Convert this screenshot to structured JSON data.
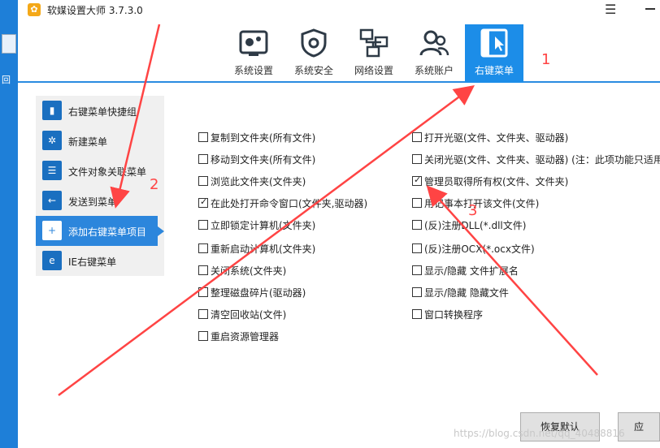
{
  "app": {
    "title": "软媒设置大师 3.7.3.0",
    "logo_icon": "gear-logo-icon"
  },
  "desktop": {
    "icon_label": "回"
  },
  "nav": {
    "tabs": [
      {
        "label": "系统设置",
        "icon": "motherboard-icon"
      },
      {
        "label": "系统安全",
        "icon": "shield-icon"
      },
      {
        "label": "网络设置",
        "icon": "network-icon"
      },
      {
        "label": "系统账户",
        "icon": "users-icon"
      },
      {
        "label": "右键菜单",
        "icon": "context-menu-icon",
        "active": true
      }
    ],
    "accent_color": "#1c8de8"
  },
  "sidebar": {
    "items": [
      {
        "label": "右键菜单快捷组",
        "icon": "shortcut-group-icon"
      },
      {
        "label": "新建菜单",
        "icon": "new-menu-icon"
      },
      {
        "label": "文件对象关联菜单",
        "icon": "file-association-icon"
      },
      {
        "label": "发送到菜单",
        "icon": "send-to-icon"
      },
      {
        "label": "添加右键菜单项目",
        "icon": "add-item-icon",
        "active": true
      },
      {
        "label": "IE右键菜单",
        "icon": "ie-icon"
      }
    ]
  },
  "options_left": [
    {
      "label": "复制到文件夹(所有文件)",
      "checked": false
    },
    {
      "label": "移动到文件夹(所有文件)",
      "checked": false
    },
    {
      "label": "浏览此文件夹(文件夹)",
      "checked": false
    },
    {
      "label": "在此处打开命令窗口(文件夹,驱动器)",
      "checked": true
    },
    {
      "label": "立即锁定计算机(文件夹)",
      "checked": false
    },
    {
      "label": "重新启动计算机(文件夹)",
      "checked": false
    },
    {
      "label": "关闭系统(文件夹)",
      "checked": false
    },
    {
      "label": "整理磁盘碎片(驱动器)",
      "checked": false
    },
    {
      "label": "清空回收站(文件)",
      "checked": false
    },
    {
      "label": "重启资源管理器",
      "checked": false
    }
  ],
  "options_right": [
    {
      "label": "打开光驱(文件、文件夹、驱动器)",
      "checked": false
    },
    {
      "label": "关闭光驱(文件、文件夹、驱动器) (注：此项功能只适用",
      "checked": false
    },
    {
      "label": "管理员取得所有权(文件、文件夹)",
      "checked": true
    },
    {
      "label": "用记事本打开该文件(文件)",
      "checked": false
    },
    {
      "label": "(反)注册DLL(*.dll文件)",
      "checked": false
    },
    {
      "label": "(反)注册OCX(*.ocx文件)",
      "checked": false
    },
    {
      "label": "显示/隐藏 文件扩展名",
      "checked": false
    },
    {
      "label": "显示/隐藏 隐藏文件",
      "checked": false
    },
    {
      "label": "窗口转换程序",
      "checked": false
    }
  ],
  "buttons": {
    "restore_default": "恢复默认",
    "apply": "应"
  },
  "watermark": "https://blog.csdn.net/qq_40488816",
  "annotations": {
    "n1": "1",
    "n2": "2",
    "n3": "3",
    "color": "#ff4444"
  }
}
